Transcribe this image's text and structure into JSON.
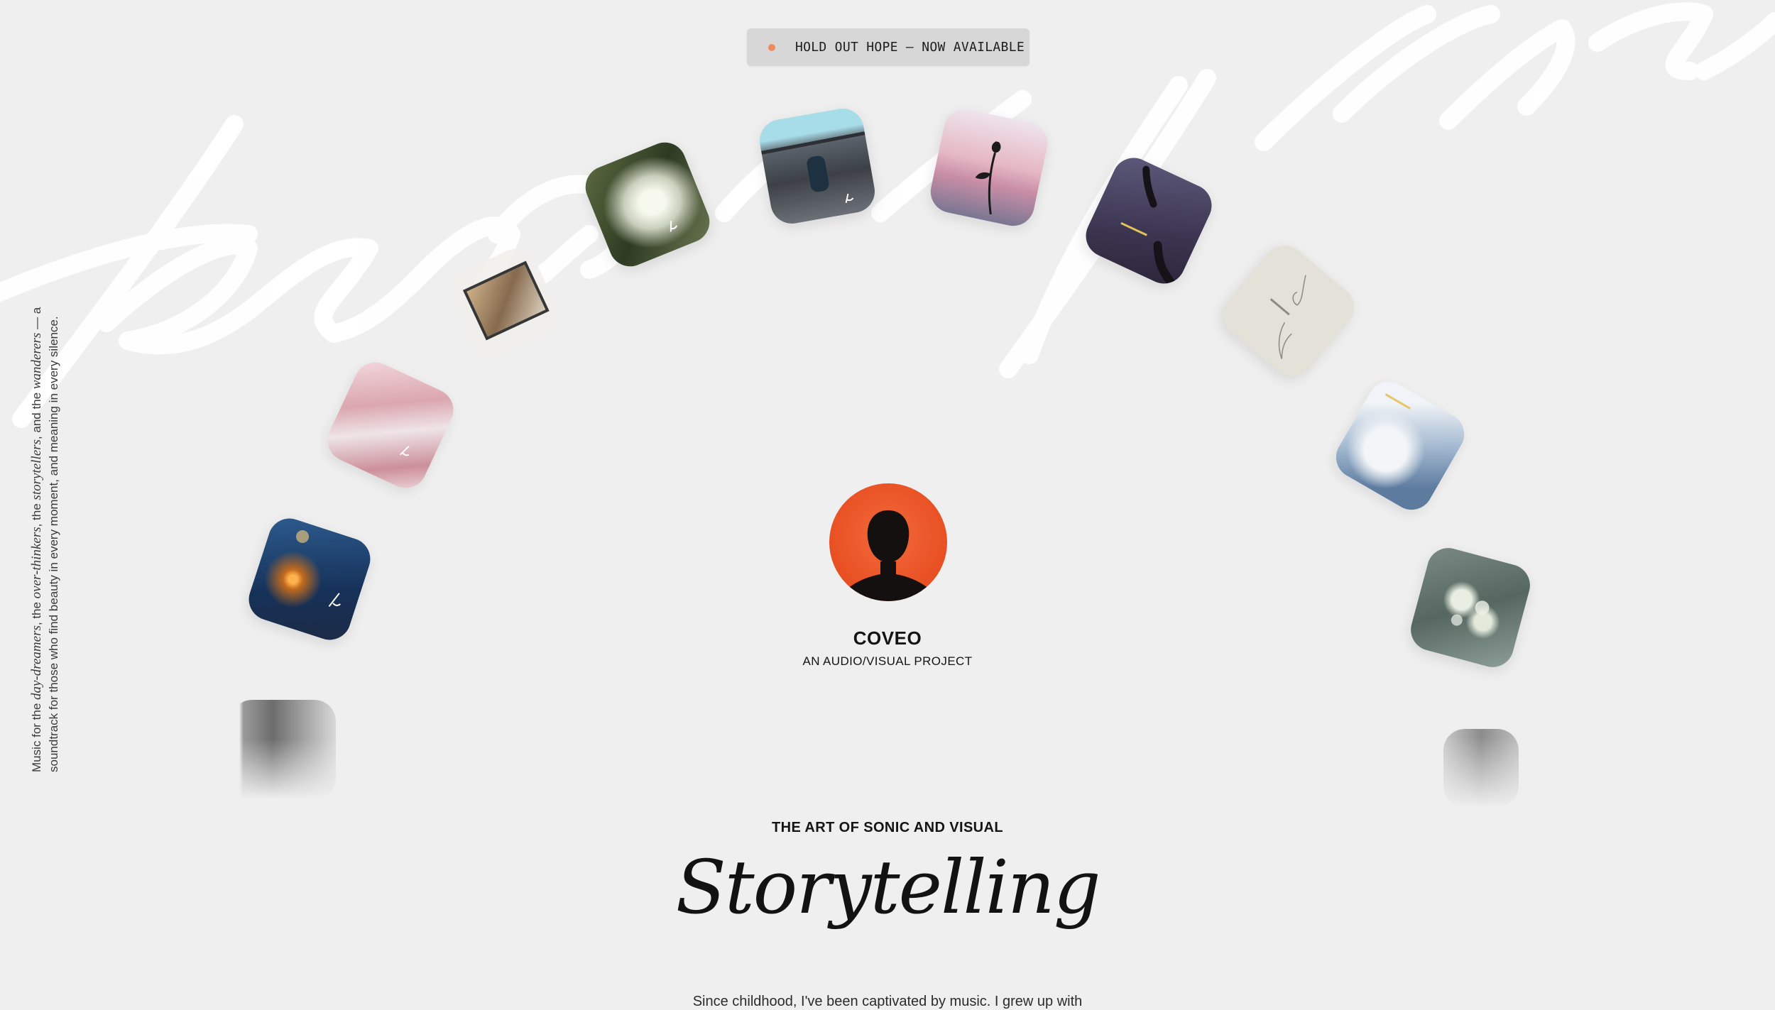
{
  "announcement": {
    "label": "HOLD OUT HOPE — NOW AVAILABLE",
    "dot_color": "#f08a5d"
  },
  "background_script": {
    "text": "these are my stories"
  },
  "side_text": {
    "p1": "Music for the ",
    "e1": "day-dreamers",
    "p2": ", the ",
    "e2": "over-thinkers",
    "p3": ", the ",
    "e3": "storytellers",
    "p4": ", and the ",
    "e4": "wanderers",
    "p5": " — a soundtrack for those who find beauty in every moment, and meaning in every silence."
  },
  "album_tiles": [
    "album-cover-streetlight",
    "album-cover-pink-blur",
    "album-cover-framed-photo",
    "album-cover-forest-canopy",
    "album-cover-bridge-walker",
    "album-cover-rose",
    "album-cover-hands",
    "album-cover-sketch-hands",
    "album-cover-clouds",
    "album-cover-white-flowers",
    "album-cover-grayscale-left",
    "album-cover-grayscale-right"
  ],
  "profile": {
    "name": "COVEO",
    "tagline": "AN AUDIO/VISUAL PROJECT",
    "avatar_color": "#e84f22"
  },
  "hero": {
    "eyebrow": "THE ART OF SONIC AND VISUAL",
    "title": "Storytelling",
    "body": "Since childhood, I've been captivated by music. I grew up with"
  }
}
